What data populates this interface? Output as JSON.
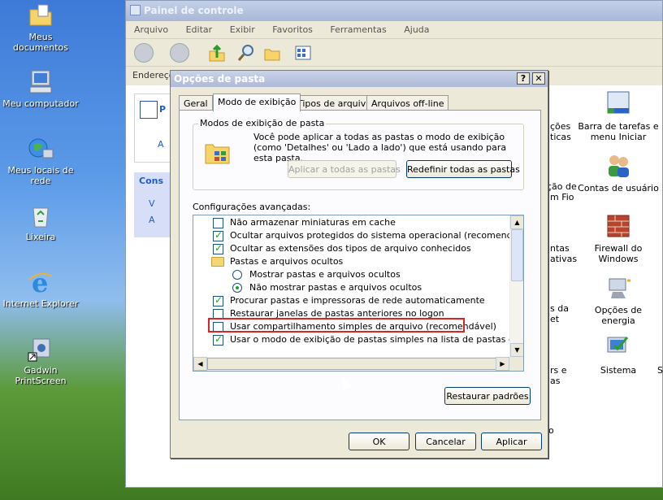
{
  "desktop": {
    "icons": [
      {
        "label": "Meus documentos"
      },
      {
        "label": "Meu computador"
      },
      {
        "label": "Meus locais de rede"
      },
      {
        "label": "Lixeira"
      },
      {
        "label": "Internet Explorer"
      },
      {
        "label": "Gadwin PrintScreen"
      }
    ]
  },
  "explorer": {
    "title": "Painel de controle",
    "menu": [
      "Arquivo",
      "Editar",
      "Exibir",
      "Favoritos",
      "Ferramentas",
      "Ajuda"
    ],
    "address_label": "Endereço",
    "side_header": "Cons",
    "side_letters": [
      "V",
      "A"
    ],
    "side_top_letter": "A",
    "side_top_title": "P",
    "items": [
      {
        "label": "Barra de tarefas e menu Iniciar"
      },
      {
        "label": "Contas de usuário"
      },
      {
        "label": "Firewall do Windows"
      },
      {
        "label": "Opções de energia"
      },
      {
        "label": "Sistema"
      }
    ],
    "partials": [
      "ções",
      "ticas",
      "ção de",
      "m Fio",
      "ntas",
      "ativas",
      "s da",
      "et",
      "rs e",
      "as",
      "o",
      "S"
    ]
  },
  "dialog": {
    "title": "Opções de pasta",
    "help_label": "?",
    "close_label": "✕",
    "tabs": [
      "Geral",
      "Modo de exibição",
      "Tipos de arquivo",
      "Arquivos off-line"
    ],
    "group": {
      "legend": "Modos de exibição de pasta",
      "text": "Você pode aplicar a todas as pastas o modo de exibição (como 'Detalhes' ou 'Lado a lado') que está usando para esta pasta.",
      "apply_all": "Aplicar a todas as pastas",
      "reset_all": "Redefinir todas as pastas"
    },
    "advanced_label": "Configurações avançadas:",
    "settings": [
      {
        "kind": "checkbox",
        "checked": false,
        "label": "Não armazenar miniaturas em cache"
      },
      {
        "kind": "checkbox",
        "checked": true,
        "label": "Ocultar arquivos protegidos do sistema operacional (recomendado)"
      },
      {
        "kind": "checkbox",
        "checked": true,
        "label": "Ocultar as extensões dos tipos de arquivo conhecidos"
      },
      {
        "kind": "folder",
        "label": "Pastas e arquivos ocultos"
      },
      {
        "kind": "radio",
        "checked": false,
        "label": "Mostrar pastas e arquivos ocultos"
      },
      {
        "kind": "radio",
        "checked": true,
        "label": "Não mostrar pastas e arquivos ocultos"
      },
      {
        "kind": "checkbox",
        "checked": true,
        "label": "Procurar pastas e impressoras de rede automaticamente"
      },
      {
        "kind": "checkbox",
        "checked": false,
        "label": "Restaurar janelas de pastas anteriores no logon"
      },
      {
        "kind": "checkbox",
        "checked": false,
        "label": "Usar compartilhamento simples de arquivo (recomendável)"
      },
      {
        "kind": "checkbox",
        "checked": true,
        "label": "Usar o modo de exibição de pastas simples na lista de pastas do Explorer"
      }
    ],
    "restore_defaults": "Restaurar padrões",
    "ok": "OK",
    "cancel": "Cancelar",
    "apply": "Aplicar",
    "highlight_color": "#d92525"
  }
}
